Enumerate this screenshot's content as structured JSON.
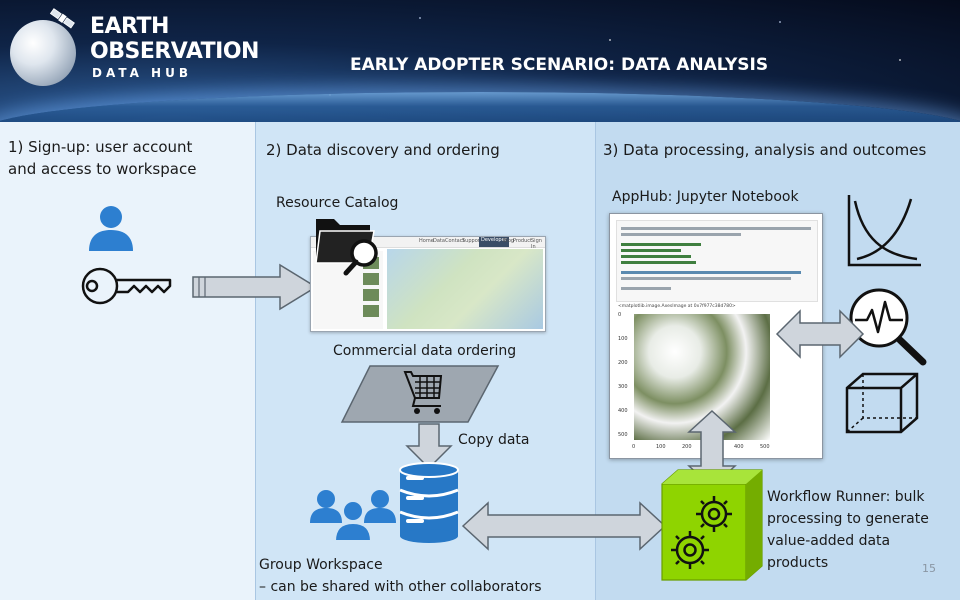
{
  "header": {
    "logo_line1": "EARTH",
    "logo_line2": "OBSERVATION",
    "logo_sub": "DATA HUB",
    "slide_title": "EARLY ADOPTER SCENARIO: DATA ANALYSIS"
  },
  "panel1": {
    "title_line1": "1) Sign-up: user account",
    "title_line2": "and access to workspace"
  },
  "panel2": {
    "title": "2) Data discovery and ordering",
    "resource_catalog": "Resource Catalog",
    "commercial_ordering": "Commercial data ordering",
    "copy_data": "Copy data",
    "group_ws_line1": "Group Workspace",
    "group_ws_line2": "– can be shared with other collaborators",
    "catalog_nav": [
      "Home",
      "Data",
      "Contact",
      "Support",
      "Developer",
      "Blog",
      "Product",
      "Sign In"
    ]
  },
  "panel3": {
    "title": "3) Data processing, analysis and outcomes",
    "apphub": "AppHub: Jupyter Notebook",
    "workflow_line1": "Workflow Runner: bulk",
    "workflow_line2": "processing to generate",
    "workflow_line3": "value-added data",
    "workflow_line4": "products",
    "notebook_out": "<matplotlib.image.AxesImage at 0x7f977c38d780>",
    "yticks": [
      "0",
      "100",
      "200",
      "300",
      "400",
      "500"
    ],
    "xticks": [
      "0",
      "100",
      "200",
      "300",
      "400",
      "500"
    ]
  },
  "page_number": "15",
  "colors": {
    "person_blue": "#2d7fd0",
    "arrow_fill": "#cfd5dc",
    "runner_green": "#8fd400",
    "database_blue": "#2778c6"
  },
  "icons": [
    "satellite-icon",
    "globe-icon",
    "user-icon",
    "key-icon",
    "folder-search-icon",
    "cart-icon",
    "database-icon",
    "group-icon",
    "chart-icon",
    "magnifier-waveform-icon",
    "cube-icon",
    "gears-icon"
  ]
}
